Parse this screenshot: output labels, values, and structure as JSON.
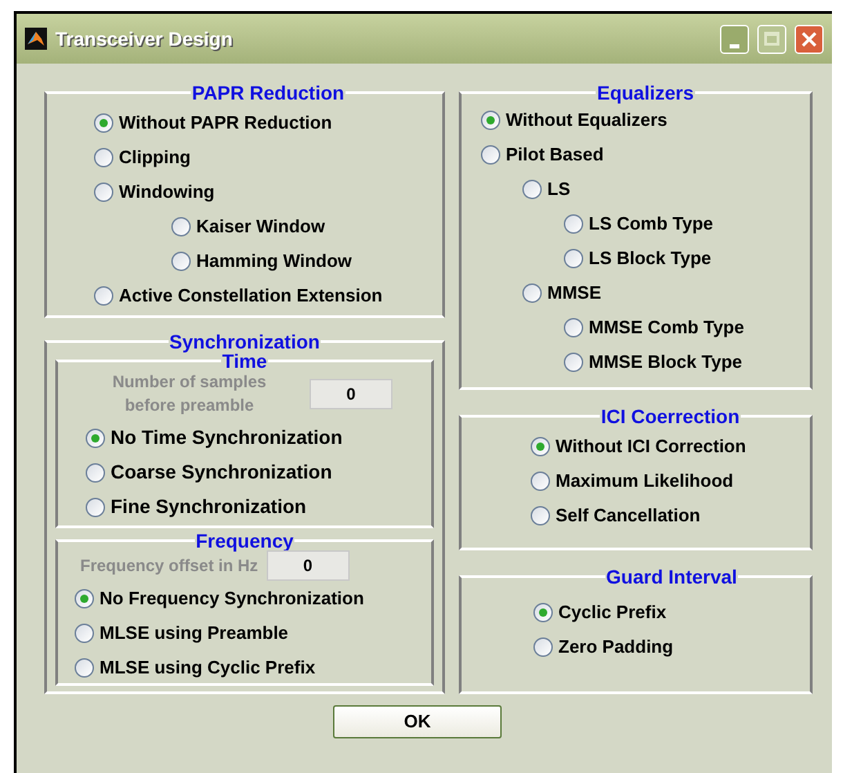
{
  "window": {
    "title": "Transceiver Design"
  },
  "papr_reduction": {
    "title": "PAPR Reduction",
    "options": [
      {
        "label": "Without PAPR Reduction",
        "selected": true
      },
      {
        "label": "Clipping",
        "selected": false
      },
      {
        "label": "Windowing",
        "selected": false,
        "children": [
          {
            "label": "Kaiser Window",
            "selected": false
          },
          {
            "label": "Hamming Window",
            "selected": false
          }
        ]
      },
      {
        "label": "Active Constellation Extension",
        "selected": false
      }
    ]
  },
  "synchronization": {
    "title": "Synchronization",
    "time": {
      "title": "Time",
      "field": {
        "label": "Number of samples before preamble",
        "value": "0",
        "disabled": true
      },
      "options": [
        {
          "label": "No Time Synchronization",
          "selected": true
        },
        {
          "label": "Coarse Synchronization",
          "selected": false
        },
        {
          "label": "Fine Synchronization",
          "selected": false
        }
      ]
    },
    "frequency": {
      "title": "Frequency",
      "field": {
        "label": "Frequency offset in Hz",
        "value": "0",
        "disabled": true
      },
      "options": [
        {
          "label": "No Frequency Synchronization",
          "selected": true
        },
        {
          "label": "MLSE using Preamble",
          "selected": false
        },
        {
          "label": "MLSE using Cyclic Prefix",
          "selected": false
        }
      ]
    }
  },
  "equalizers": {
    "title": "Equalizers",
    "options": [
      {
        "label": "Without Equalizers",
        "selected": true
      },
      {
        "label": "Pilot Based",
        "selected": false,
        "children": [
          {
            "label": "LS",
            "selected": false,
            "children": [
              {
                "label": "LS Comb Type",
                "selected": false
              },
              {
                "label": "LS Block Type",
                "selected": false
              }
            ]
          },
          {
            "label": "MMSE",
            "selected": false,
            "children": [
              {
                "label": "MMSE Comb Type",
                "selected": false
              },
              {
                "label": "MMSE Block Type",
                "selected": false
              }
            ]
          }
        ]
      }
    ]
  },
  "ici_correction": {
    "title": "ICI Coerrection",
    "options": [
      {
        "label": "Without ICI Correction",
        "selected": true
      },
      {
        "label": "Maximum Likelihood",
        "selected": false
      },
      {
        "label": "Self Cancellation",
        "selected": false
      }
    ]
  },
  "guard_interval": {
    "title": "Guard Interval",
    "options": [
      {
        "label": "Cyclic Prefix",
        "selected": true
      },
      {
        "label": "Zero Padding",
        "selected": false
      }
    ]
  },
  "buttons": [
    {
      "label": "OK"
    }
  ]
}
